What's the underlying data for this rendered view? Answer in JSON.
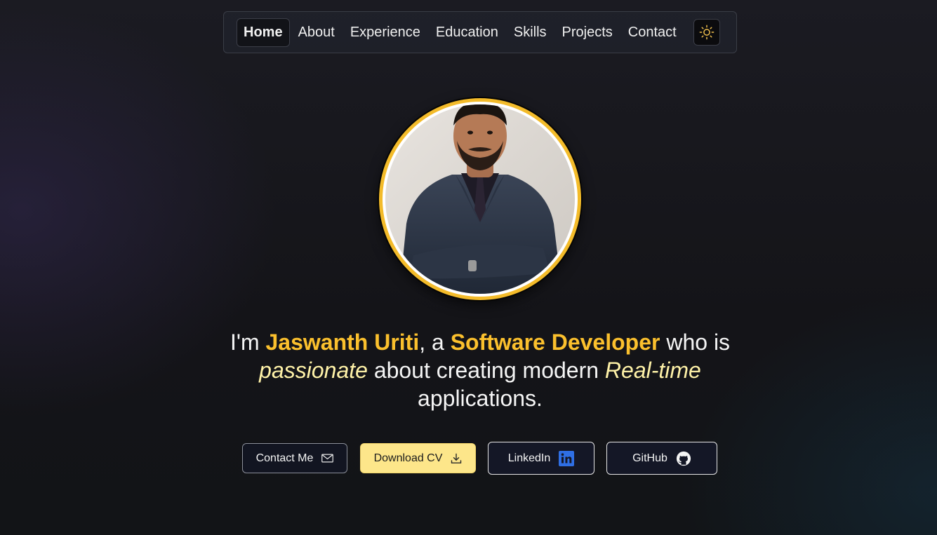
{
  "nav": {
    "items": [
      {
        "label": "Home",
        "active": true
      },
      {
        "label": "About"
      },
      {
        "label": "Experience"
      },
      {
        "label": "Education"
      },
      {
        "label": "Skills"
      },
      {
        "label": "Projects"
      },
      {
        "label": "Contact"
      }
    ],
    "theme_toggle_icon": "sun-icon"
  },
  "profile": {
    "photo_icon": "profile-photo",
    "ring_color": "#f3bb2a"
  },
  "intro": {
    "prefix": "I'm ",
    "name": "Jaswanth Uriti",
    "mid1": ", a ",
    "role": "Software Developer",
    "mid2": " who is ",
    "word1": "passionate",
    "mid3": " about creating modern ",
    "word2": "Real-time",
    "suffix": " applications."
  },
  "buttons": {
    "contact": {
      "label": "Contact Me",
      "icon": "mail-icon"
    },
    "cv": {
      "label": "Download CV",
      "icon": "download-icon"
    },
    "linkedin": {
      "label": "LinkedIn",
      "icon": "linkedin-icon"
    },
    "github": {
      "label": "GitHub",
      "icon": "github-icon"
    }
  },
  "colors": {
    "accent": "#fbc02d",
    "emphasis": "#fff2a8",
    "cv_button": "#fde68a",
    "linkedin_blue": "#2f6fe4"
  }
}
